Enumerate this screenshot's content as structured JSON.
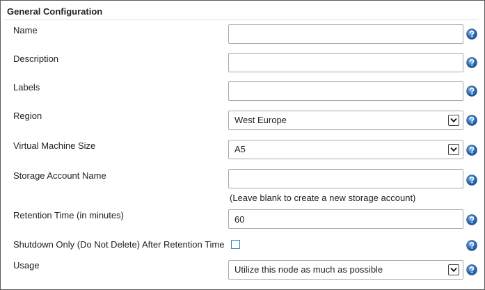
{
  "section": {
    "title": "General Configuration"
  },
  "fields": {
    "name": {
      "label": "Name",
      "value": ""
    },
    "description": {
      "label": "Description",
      "value": ""
    },
    "labels": {
      "label": "Labels",
      "value": ""
    },
    "region": {
      "label": "Region",
      "selected": "West Europe"
    },
    "vm_size": {
      "label": "Virtual Machine Size",
      "selected": "A5"
    },
    "storage_account": {
      "label": "Storage Account Name",
      "value": "",
      "hint": "(Leave blank to create a new storage account)"
    },
    "retention_time": {
      "label": "Retention Time (in minutes)",
      "value": "60"
    },
    "shutdown_only": {
      "label": "Shutdown Only (Do Not Delete) After Retention Time",
      "checked": false
    },
    "usage": {
      "label": "Usage",
      "selected": "Utilize this node as much as possible"
    }
  },
  "icons": {
    "help": "help-icon",
    "dropdown": "chevron-down-icon"
  },
  "colors": {
    "help_icon_fill": "#2d6db5",
    "checkbox_border": "#3b7fbf"
  }
}
